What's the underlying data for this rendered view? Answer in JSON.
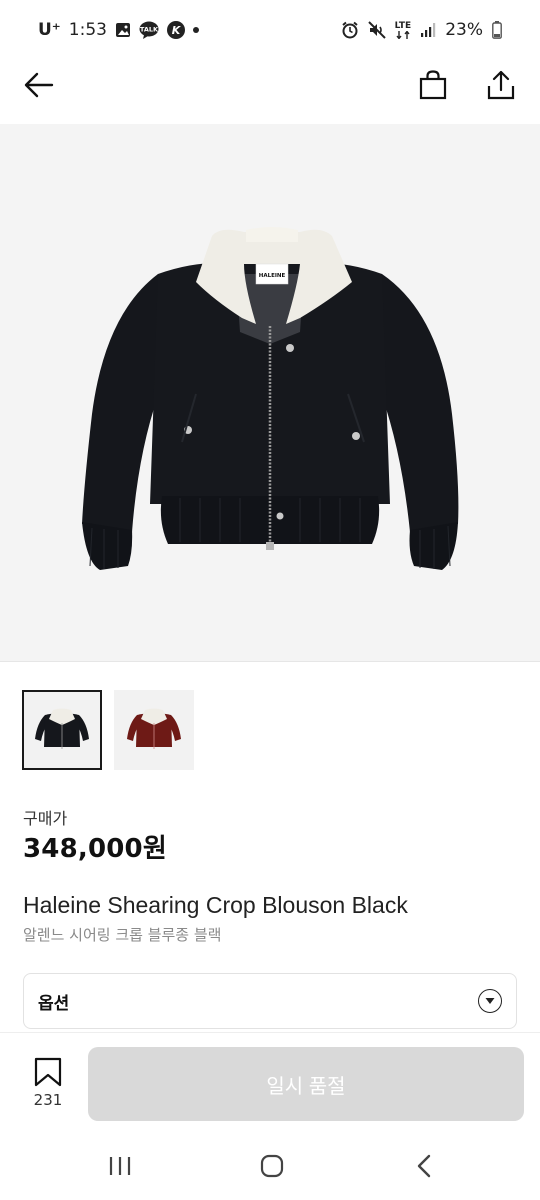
{
  "status_bar": {
    "carrier": "U⁺",
    "time": "1:53",
    "battery": "23%",
    "icons": [
      "gallery-icon",
      "talk-icon",
      "k-app-icon",
      "notification-dot",
      "alarm-icon",
      "mute-icon",
      "lte-icon",
      "signal-icon",
      "battery-icon"
    ],
    "lte_label": "LTE",
    "talk_label": "TALK",
    "k_label": "K"
  },
  "top_bar": {
    "icons": [
      "back-arrow-icon",
      "shopping-bag-icon",
      "share-icon"
    ]
  },
  "product": {
    "brand_tag": "HALEINE",
    "price_label": "구매가",
    "price": "348,000원",
    "name_en": "Haleine Shearing Crop Blouson Black",
    "name_ko": "알렌느 시어링 크롭 블루종 블랙",
    "thumbnails": [
      {
        "color_name": "black",
        "color": "#15171c",
        "selected": true
      },
      {
        "color_name": "burgundy",
        "color": "#6e1a16",
        "selected": false
      }
    ]
  },
  "option": {
    "label": "옵션"
  },
  "bottom_bar": {
    "wish_count": "231",
    "soldout_label": "일시 품절"
  },
  "colors": {
    "jacket_body": "#14161b",
    "collar": "#efede6",
    "hero_bg": "#f4f4f4",
    "disabled_button": "#d9d9d9"
  }
}
